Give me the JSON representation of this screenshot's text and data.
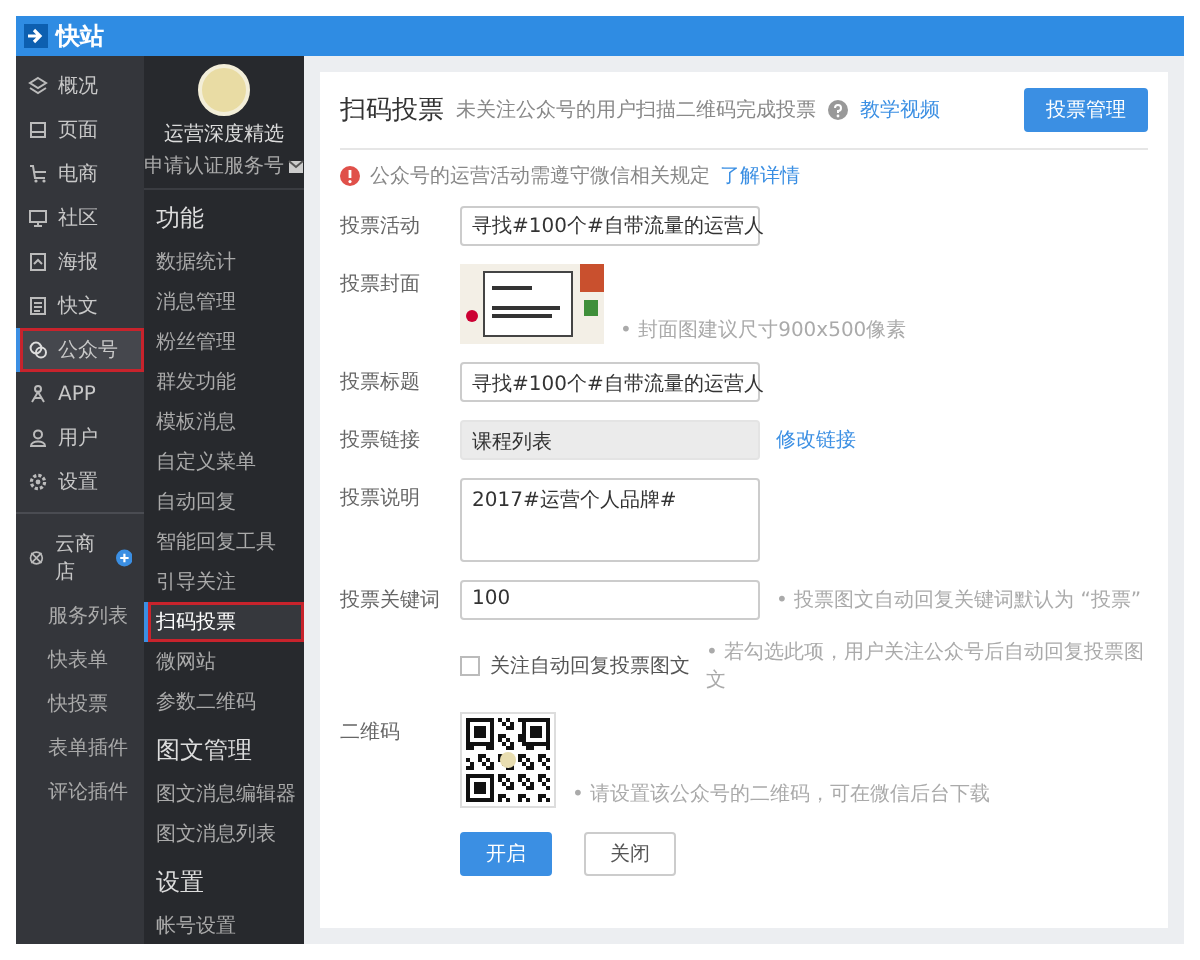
{
  "app": {
    "logo": "快站"
  },
  "nav": [
    {
      "label": "概况",
      "selected": false
    },
    {
      "label": "页面",
      "selected": false
    },
    {
      "label": "电商",
      "selected": false
    },
    {
      "label": "社区",
      "selected": false
    },
    {
      "label": "海报",
      "selected": false
    },
    {
      "label": "快文",
      "selected": false
    },
    {
      "label": "公众号",
      "selected": true
    },
    {
      "label": "APP",
      "selected": false
    },
    {
      "label": "用户",
      "selected": false
    },
    {
      "label": "设置",
      "selected": false
    }
  ],
  "store": {
    "label": "云商店",
    "items": [
      {
        "label": "服务列表",
        "selected": false
      },
      {
        "label": "快表单",
        "selected": false
      },
      {
        "label": "快投票",
        "selected": false
      },
      {
        "label": "表单插件",
        "selected": false
      },
      {
        "label": "评论插件",
        "selected": false
      }
    ]
  },
  "account": {
    "name": "运营深度精选",
    "subtitle": "申请认证服务号"
  },
  "menu_sections": [
    {
      "title": "功能",
      "items": [
        {
          "label": "数据统计",
          "selected": false
        },
        {
          "label": "消息管理",
          "selected": false
        },
        {
          "label": "粉丝管理",
          "selected": false
        },
        {
          "label": "群发功能",
          "selected": false
        },
        {
          "label": "模板消息",
          "selected": false
        },
        {
          "label": "自定义菜单",
          "selected": false
        },
        {
          "label": "自动回复",
          "selected": false
        },
        {
          "label": "智能回复工具",
          "selected": false
        },
        {
          "label": "引导关注",
          "selected": false
        },
        {
          "label": "扫码投票",
          "selected": true
        },
        {
          "label": "微网站",
          "selected": false
        },
        {
          "label": "参数二维码",
          "selected": false
        }
      ]
    },
    {
      "title": "图文管理",
      "items": [
        {
          "label": "图文消息编辑器",
          "selected": false
        },
        {
          "label": "图文消息列表",
          "selected": false
        }
      ]
    },
    {
      "title": "设置",
      "items": [
        {
          "label": "帐号设置",
          "selected": false
        }
      ]
    }
  ],
  "page": {
    "title": "扫码投票",
    "description": "未关注公众号的用户扫描二维码完成投票",
    "help_link": "教学视频",
    "action_button": "投票管理"
  },
  "notice": {
    "text": "公众号的运营活动需遵守微信相关规定",
    "link": "了解详情"
  },
  "form": [
    {
      "kind": "select",
      "label": "投票活动",
      "value": "寻找#100个#自带流量的运营人"
    },
    {
      "kind": "image",
      "label": "投票封面",
      "hint": "• 封面图建议尺寸900x500像素"
    },
    {
      "kind": "input",
      "label": "投票标题",
      "value": "寻找#100个#自带流量的运营人"
    },
    {
      "kind": "readonly",
      "label": "投票链接",
      "value": "课程列表",
      "link": "修改链接"
    },
    {
      "kind": "textarea",
      "label": "投票说明",
      "value": "2017#运营个人品牌#"
    },
    {
      "kind": "input",
      "label": "投票关键词",
      "value": "100",
      "hint": "• 投票图文自动回复关键词默认为 “投票”"
    },
    {
      "kind": "checkbox",
      "label": "关注自动回复投票图文",
      "checked": false,
      "hint": "• 若勾选此项，用户关注公众号后自动回复投票图文"
    },
    {
      "kind": "qr",
      "label": "二维码",
      "hint": "• 请设置该公众号的二维码，可在微信后台下载"
    }
  ],
  "buttons": [
    {
      "label": "开启",
      "kind": "primary"
    },
    {
      "label": "关闭",
      "kind": "default"
    }
  ]
}
